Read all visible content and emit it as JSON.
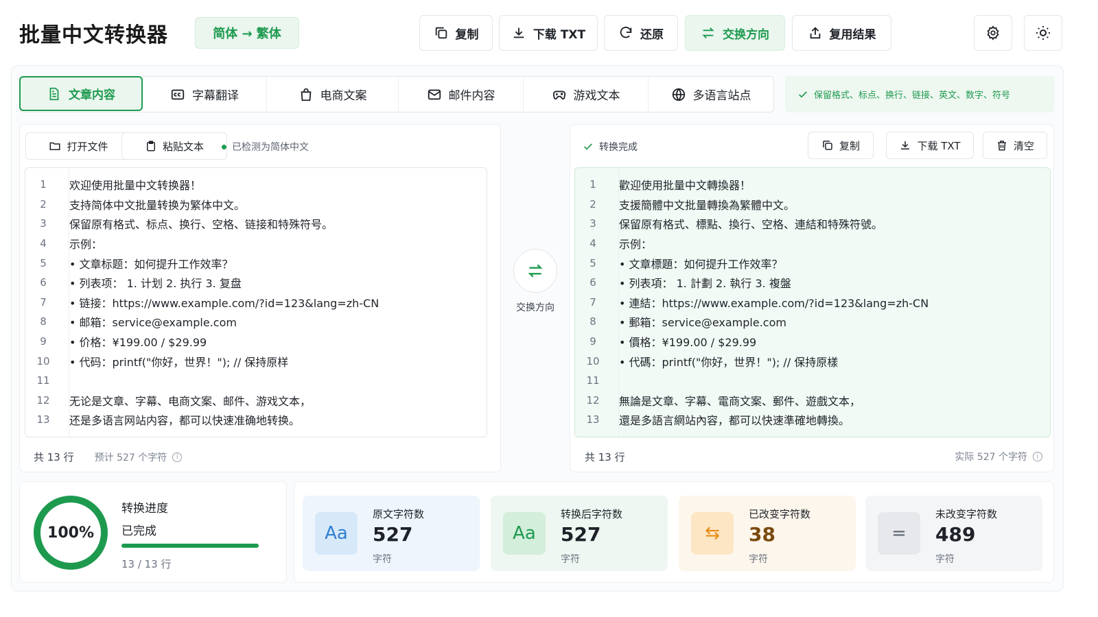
{
  "header": {
    "title": "批量中文转换器",
    "mode": "简体 → 繁体",
    "copy": "复制",
    "download_txt": "下载 TXT",
    "restore": "还原",
    "swap_direction": "交换方向",
    "reuse_result": "复用结果",
    "settings_icon": "gear-icon",
    "theme_icon": "sun-icon"
  },
  "tabs": [
    {
      "label": "文章内容",
      "icon": "document-icon",
      "active": true
    },
    {
      "label": "字幕翻译",
      "icon": "cc-icon",
      "active": false
    },
    {
      "label": "电商文案",
      "icon": "shopping-bag-icon",
      "active": false
    },
    {
      "label": "邮件内容",
      "icon": "mail-icon",
      "active": false
    },
    {
      "label": "游戏文本",
      "icon": "gamepad-icon",
      "active": false
    },
    {
      "label": "多语言站点",
      "icon": "globe-icon",
      "active": false
    }
  ],
  "keep_note": "保留格式、标点、换行、链接、英文、数字、符号",
  "input_panel": {
    "open_file": "打开文件",
    "paste_text": "粘贴文本",
    "detected": "已检测为简体中文",
    "lines": [
      "欢迎使用批量中文转换器！",
      "支持简体中文批量转换为繁体中文。",
      "保留原有格式、标点、换行、空格、链接和特殊符号。",
      "示例：",
      "• 文章标题：如何提升工作效率？",
      "• 列表项： 1. 计划   2. 执行   3. 复盘",
      "• 链接：https://www.example.com/?id=123&lang=zh-CN",
      "• 邮箱：service@example.com",
      "• 价格：¥199.00 / $29.99",
      "• 代码：printf(\"你好，世界！\"); // 保持原样",
      "",
      "无论是文章、字幕、电商文案、邮件、游戏文本，",
      "还是多语言网站内容，都可以快速准确地转换。"
    ],
    "line_count": "共 13 行",
    "char_estimate": "预计 527 个字符"
  },
  "swap": {
    "label": "交换方向"
  },
  "output_panel": {
    "status": "转换完成",
    "copy": "复制",
    "download_txt": "下载 TXT",
    "clear": "清空",
    "lines": [
      "歡迎使用批量中文轉換器！",
      "支援簡體中文批量轉換為繁體中文。",
      "保留原有格式、標點、換行、空格、連結和特殊符號。",
      "示例：",
      "• 文章標題：如何提升工作效率？",
      "• 列表項： 1. 計劃   2. 執行   3. 複盤",
      "• 連結：https://www.example.com/?id=123&lang=zh-CN",
      "• 郵箱：service@example.com",
      "• 價格：¥199.00 / $29.99",
      "• 代碼：printf(\"你好，世界！\"); // 保持原樣",
      "",
      "無論是文章、字幕、電商文案、郵件、遊戲文本，",
      "還是多語言網站內容，都可以快速準確地轉換。"
    ],
    "line_count": "共 13 行",
    "char_actual": "实际 527 个字符"
  },
  "progress": {
    "percent_text": "100%",
    "fraction": 1.0,
    "title": "转换进度",
    "status": "已完成",
    "rows": "13 / 13 行"
  },
  "stats": [
    {
      "label": "原文字符数",
      "value": "527",
      "unit": "字符",
      "icon": "Aa",
      "bg": "#eef5fc",
      "icon_bg": "#d7e8f8",
      "icon_color": "#2f7fd1",
      "value_color": "#1f2329"
    },
    {
      "label": "转换后字符数",
      "value": "527",
      "unit": "字符",
      "icon": "Aa",
      "bg": "#eef7f1",
      "icon_bg": "#d3eedb",
      "icon_color": "#1e9a4f",
      "value_color": "#1f2329"
    },
    {
      "label": "已改变字符数",
      "value": "38",
      "unit": "字符",
      "icon": "⇆",
      "bg": "#fdf6ec",
      "icon_bg": "#fde6c3",
      "icon_color": "#e88a16",
      "value_color": "#7a4a0e"
    },
    {
      "label": "未改变字符数",
      "value": "489",
      "unit": "字符",
      "icon": "=",
      "bg": "#f4f5f7",
      "icon_bg": "#e6e8eb",
      "icon_color": "#5b6370",
      "value_color": "#1f2329"
    }
  ],
  "colors": {
    "accent": "#1e9a4f",
    "border": "#e3e5e8"
  }
}
